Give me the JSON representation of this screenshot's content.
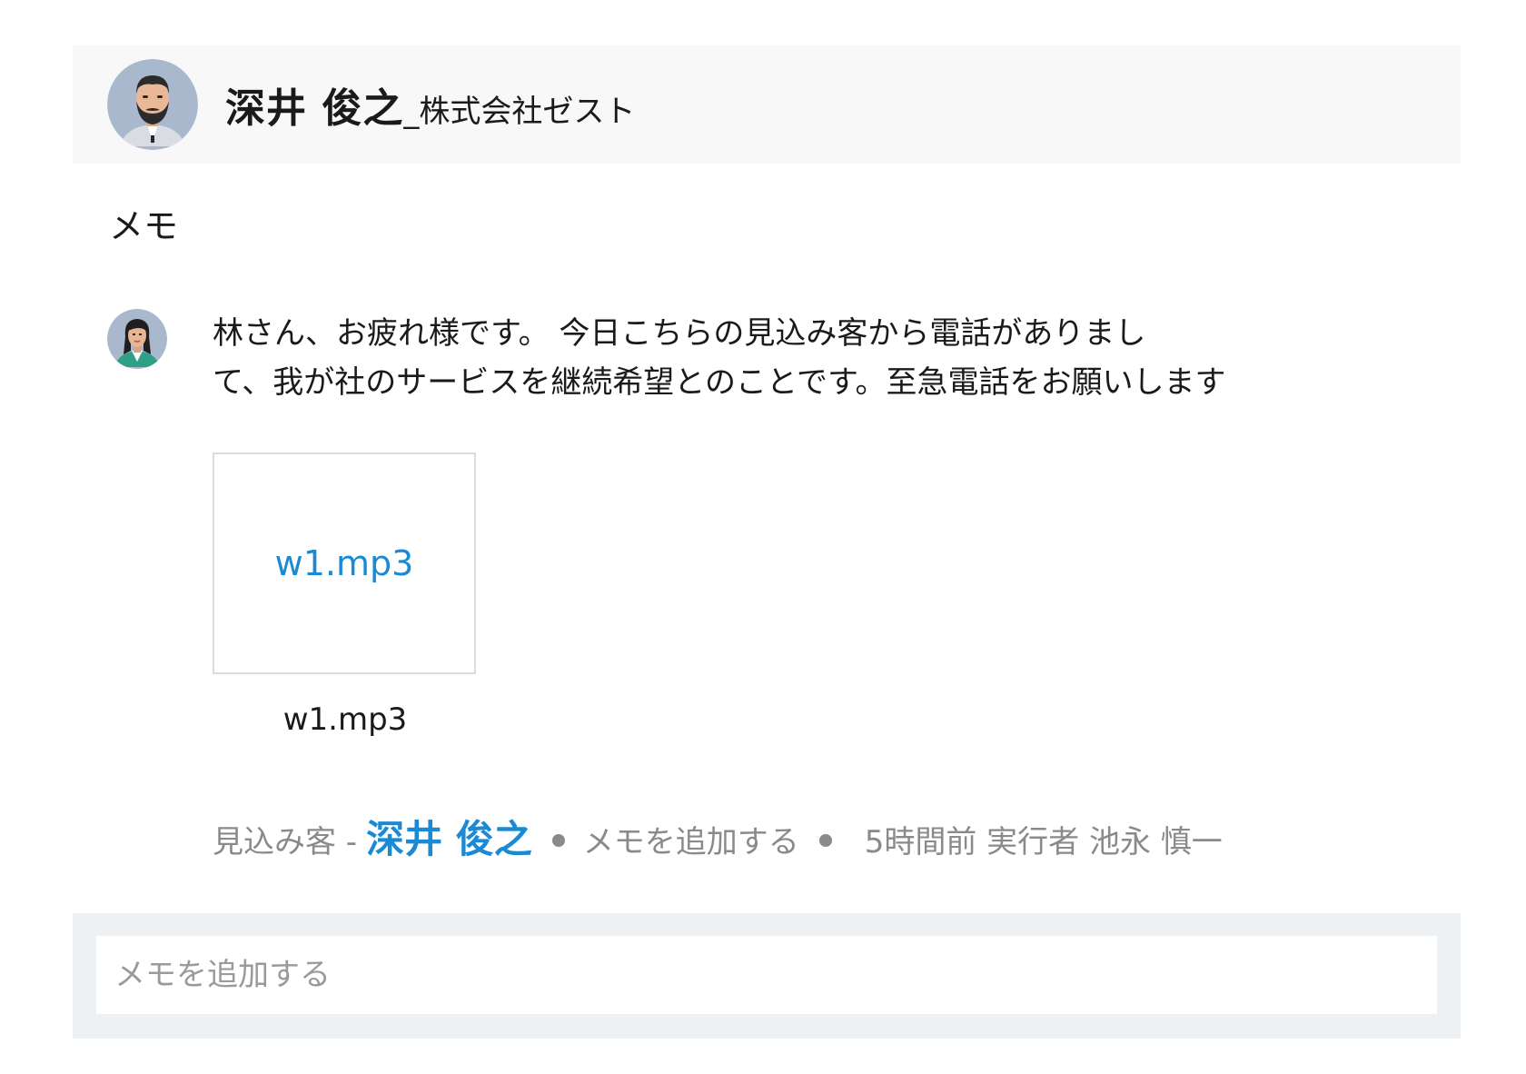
{
  "contact": {
    "name": "深井 俊之",
    "company": "_株式会社ゼスト",
    "avatar_icon": "man-with-beard-avatar"
  },
  "section_title": "メモ",
  "memo": {
    "author_avatar_icon": "woman-avatar",
    "text": "林さん、お疲れ様です。 今日こちらの見込み客から電話がありまし\nて、我が社のサービスを継続希望とのことです。至急電話をお願いします",
    "attachment": {
      "link_text": "w1.mp3",
      "caption": "w1.mp3"
    },
    "meta": {
      "prospect_label": "見込み客 -",
      "prospect_name": "深井 俊之",
      "add_memo": "メモを追加する",
      "time_and_actor": "5時間前 実行者 池永 慎一"
    }
  },
  "composer": {
    "placeholder": "メモを追加する"
  },
  "colors": {
    "link": "#1a8ad4",
    "header_bg": "#f8f8f8",
    "composer_bg": "#eef1f4",
    "meta_text": "#8a8a8a"
  }
}
